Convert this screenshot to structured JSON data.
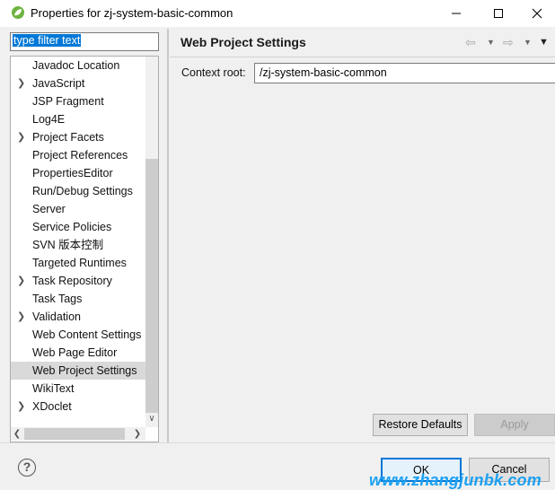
{
  "window": {
    "title": "Properties for zj-system-basic-common",
    "icons": {
      "app": "eclipse-spring-icon",
      "minimize": "minimize-icon",
      "maximize": "maximize-icon",
      "close": "close-icon"
    }
  },
  "filter": {
    "value": "type filter text"
  },
  "tree": {
    "items": [
      {
        "label": "Javadoc Location",
        "expandable": false,
        "selected": false
      },
      {
        "label": "JavaScript",
        "expandable": true,
        "selected": false
      },
      {
        "label": "JSP Fragment",
        "expandable": false,
        "selected": false
      },
      {
        "label": "Log4E",
        "expandable": false,
        "selected": false
      },
      {
        "label": "Project Facets",
        "expandable": true,
        "selected": false
      },
      {
        "label": "Project References",
        "expandable": false,
        "selected": false
      },
      {
        "label": "PropertiesEditor",
        "expandable": false,
        "selected": false
      },
      {
        "label": "Run/Debug Settings",
        "expandable": false,
        "selected": false
      },
      {
        "label": "Server",
        "expandable": false,
        "selected": false
      },
      {
        "label": "Service Policies",
        "expandable": false,
        "selected": false
      },
      {
        "label": "SVN 版本控制",
        "expandable": false,
        "selected": false
      },
      {
        "label": "Targeted Runtimes",
        "expandable": false,
        "selected": false
      },
      {
        "label": "Task Repository",
        "expandable": true,
        "selected": false
      },
      {
        "label": "Task Tags",
        "expandable": false,
        "selected": false
      },
      {
        "label": "Validation",
        "expandable": true,
        "selected": false
      },
      {
        "label": "Web Content Settings",
        "expandable": false,
        "selected": false
      },
      {
        "label": "Web Page Editor",
        "expandable": false,
        "selected": false
      },
      {
        "label": "Web Project Settings",
        "expandable": false,
        "selected": true
      },
      {
        "label": "WikiText",
        "expandable": false,
        "selected": false
      },
      {
        "label": "XDoclet",
        "expandable": true,
        "selected": false
      }
    ]
  },
  "page": {
    "title": "Web Project Settings",
    "context_root_label": "Context root:",
    "context_root_value": "/zj-system-basic-common"
  },
  "buttons": {
    "restore_defaults": "Restore Defaults",
    "apply": "Apply",
    "ok": "OK",
    "cancel": "Cancel"
  },
  "watermark": "www.zhangjunbk.com",
  "colors": {
    "selection": "#0078d7",
    "watermark": "#1da1f2",
    "selected_row": "#d9d9d9"
  }
}
